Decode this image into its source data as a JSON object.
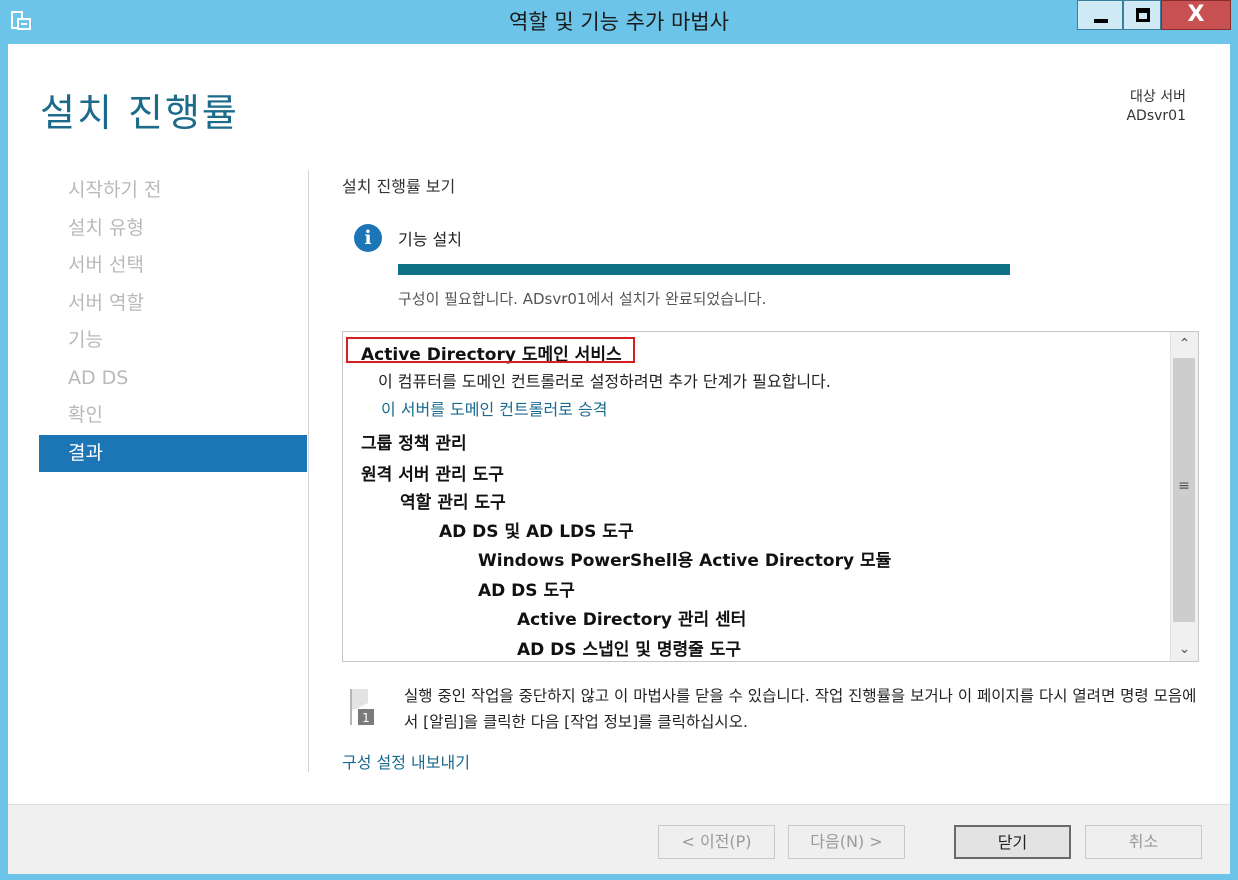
{
  "window": {
    "title": "역할 및 기능 추가 마법사",
    "controls": {
      "minimize": "minimize-icon",
      "maximize": "maximize-icon",
      "close": "close-icon"
    },
    "close_glyph": "X"
  },
  "header": {
    "title": "설치 진행률",
    "target_label": "대상 서버",
    "target_value": "ADsvr01"
  },
  "nav": {
    "items": [
      {
        "label": "시작하기 전"
      },
      {
        "label": "설치 유형"
      },
      {
        "label": "서버 선택"
      },
      {
        "label": "서버 역할"
      },
      {
        "label": "기능"
      },
      {
        "label": "AD DS"
      },
      {
        "label": "확인"
      },
      {
        "label": "결과"
      }
    ],
    "active_index": 7
  },
  "main": {
    "heading": "설치 진행률 보기",
    "info_glyph": "i",
    "feature_label": "기능 설치",
    "progress_fraction": 1.0,
    "status": "구성이 필요합니다. ADsvr01에서 설치가 완료되었습니다.",
    "results": {
      "items": [
        {
          "text": "Active Directory 도메인 서비스",
          "level": 0
        },
        {
          "text": "그룹 정책 관리",
          "level": 0
        },
        {
          "text": "원격 서버 관리 도구",
          "level": 0
        },
        {
          "text": "역할 관리 도구",
          "level": 1
        },
        {
          "text": "AD DS 및 AD LDS 도구",
          "level": 2
        },
        {
          "text": "Windows PowerShell용 Active Directory 모듈",
          "level": 3
        },
        {
          "text": "AD DS 도구",
          "level": 3
        },
        {
          "text": "Active Directory 관리 센터",
          "level": 4
        },
        {
          "text": "AD DS 스냅인 및 명령줄 도구",
          "level": 4
        }
      ],
      "description": "이 컴퓨터를 도메인 컨트롤러로 설정하려면 추가 단계가 필요합니다.",
      "promote_link": "이 서버를 도메인 컨트롤러로 승격",
      "highlight_color": "#d62020"
    },
    "notice": "실행 중인 작업을 중단하지 않고 이 마법사를 닫을 수 있습니다. 작업 진행률을 보거나 이 페이지를 다시 열려면 명령 모음에서 [알림]을 클릭한 다음 [작업 정보]를 클릭하십시오.",
    "notice_badge": "1",
    "export_link": "구성 설정 내보내기"
  },
  "footer": {
    "prev": "< 이전(P)",
    "next": "다음(N) >",
    "close": "닫기",
    "cancel": "취소"
  },
  "colors": {
    "titlebar": "#6cc4e8",
    "accent": "#1c76b5",
    "progress": "#0f7185",
    "link": "#1a6a8f"
  }
}
